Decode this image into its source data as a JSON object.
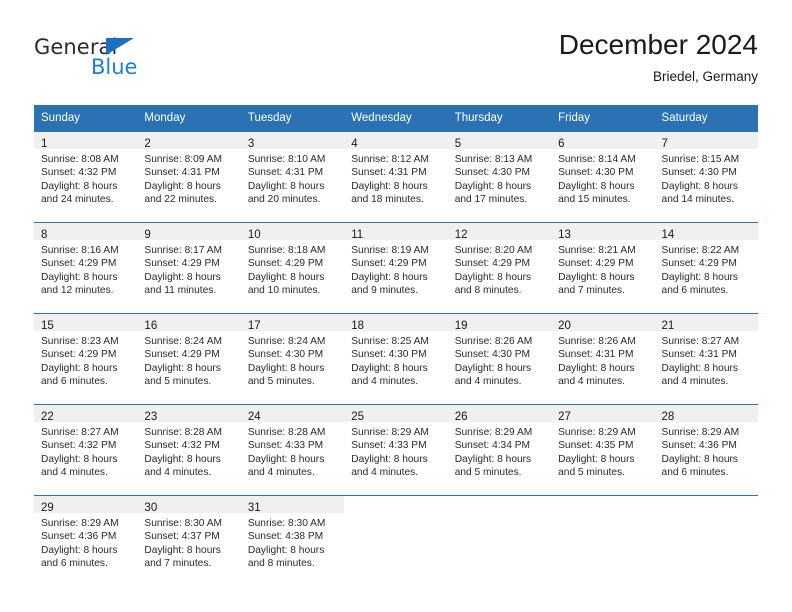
{
  "brand": {
    "name_part1": "General",
    "name_part2": "Blue",
    "accent_color": "#1b7fd4",
    "triangle_color": "#1b6ec2"
  },
  "header": {
    "title": "December 2024",
    "subtitle": "Briedel, Germany"
  },
  "calendar": {
    "header_bg": "#2b72b3",
    "daynum_bg": "#f0f0f0",
    "weekday_headers": [
      "Sunday",
      "Monday",
      "Tuesday",
      "Wednesday",
      "Thursday",
      "Friday",
      "Saturday"
    ],
    "weeks": [
      [
        {
          "day": "1",
          "lines": [
            "Sunrise: 8:08 AM",
            "Sunset: 4:32 PM",
            "Daylight: 8 hours",
            "and 24 minutes."
          ]
        },
        {
          "day": "2",
          "lines": [
            "Sunrise: 8:09 AM",
            "Sunset: 4:31 PM",
            "Daylight: 8 hours",
            "and 22 minutes."
          ]
        },
        {
          "day": "3",
          "lines": [
            "Sunrise: 8:10 AM",
            "Sunset: 4:31 PM",
            "Daylight: 8 hours",
            "and 20 minutes."
          ]
        },
        {
          "day": "4",
          "lines": [
            "Sunrise: 8:12 AM",
            "Sunset: 4:31 PM",
            "Daylight: 8 hours",
            "and 18 minutes."
          ]
        },
        {
          "day": "5",
          "lines": [
            "Sunrise: 8:13 AM",
            "Sunset: 4:30 PM",
            "Daylight: 8 hours",
            "and 17 minutes."
          ]
        },
        {
          "day": "6",
          "lines": [
            "Sunrise: 8:14 AM",
            "Sunset: 4:30 PM",
            "Daylight: 8 hours",
            "and 15 minutes."
          ]
        },
        {
          "day": "7",
          "lines": [
            "Sunrise: 8:15 AM",
            "Sunset: 4:30 PM",
            "Daylight: 8 hours",
            "and 14 minutes."
          ]
        }
      ],
      [
        {
          "day": "8",
          "lines": [
            "Sunrise: 8:16 AM",
            "Sunset: 4:29 PM",
            "Daylight: 8 hours",
            "and 12 minutes."
          ]
        },
        {
          "day": "9",
          "lines": [
            "Sunrise: 8:17 AM",
            "Sunset: 4:29 PM",
            "Daylight: 8 hours",
            "and 11 minutes."
          ]
        },
        {
          "day": "10",
          "lines": [
            "Sunrise: 8:18 AM",
            "Sunset: 4:29 PM",
            "Daylight: 8 hours",
            "and 10 minutes."
          ]
        },
        {
          "day": "11",
          "lines": [
            "Sunrise: 8:19 AM",
            "Sunset: 4:29 PM",
            "Daylight: 8 hours",
            "and 9 minutes."
          ]
        },
        {
          "day": "12",
          "lines": [
            "Sunrise: 8:20 AM",
            "Sunset: 4:29 PM",
            "Daylight: 8 hours",
            "and 8 minutes."
          ]
        },
        {
          "day": "13",
          "lines": [
            "Sunrise: 8:21 AM",
            "Sunset: 4:29 PM",
            "Daylight: 8 hours",
            "and 7 minutes."
          ]
        },
        {
          "day": "14",
          "lines": [
            "Sunrise: 8:22 AM",
            "Sunset: 4:29 PM",
            "Daylight: 8 hours",
            "and 6 minutes."
          ]
        }
      ],
      [
        {
          "day": "15",
          "lines": [
            "Sunrise: 8:23 AM",
            "Sunset: 4:29 PM",
            "Daylight: 8 hours",
            "and 6 minutes."
          ]
        },
        {
          "day": "16",
          "lines": [
            "Sunrise: 8:24 AM",
            "Sunset: 4:29 PM",
            "Daylight: 8 hours",
            "and 5 minutes."
          ]
        },
        {
          "day": "17",
          "lines": [
            "Sunrise: 8:24 AM",
            "Sunset: 4:30 PM",
            "Daylight: 8 hours",
            "and 5 minutes."
          ]
        },
        {
          "day": "18",
          "lines": [
            "Sunrise: 8:25 AM",
            "Sunset: 4:30 PM",
            "Daylight: 8 hours",
            "and 4 minutes."
          ]
        },
        {
          "day": "19",
          "lines": [
            "Sunrise: 8:26 AM",
            "Sunset: 4:30 PM",
            "Daylight: 8 hours",
            "and 4 minutes."
          ]
        },
        {
          "day": "20",
          "lines": [
            "Sunrise: 8:26 AM",
            "Sunset: 4:31 PM",
            "Daylight: 8 hours",
            "and 4 minutes."
          ]
        },
        {
          "day": "21",
          "lines": [
            "Sunrise: 8:27 AM",
            "Sunset: 4:31 PM",
            "Daylight: 8 hours",
            "and 4 minutes."
          ]
        }
      ],
      [
        {
          "day": "22",
          "lines": [
            "Sunrise: 8:27 AM",
            "Sunset: 4:32 PM",
            "Daylight: 8 hours",
            "and 4 minutes."
          ]
        },
        {
          "day": "23",
          "lines": [
            "Sunrise: 8:28 AM",
            "Sunset: 4:32 PM",
            "Daylight: 8 hours",
            "and 4 minutes."
          ]
        },
        {
          "day": "24",
          "lines": [
            "Sunrise: 8:28 AM",
            "Sunset: 4:33 PM",
            "Daylight: 8 hours",
            "and 4 minutes."
          ]
        },
        {
          "day": "25",
          "lines": [
            "Sunrise: 8:29 AM",
            "Sunset: 4:33 PM",
            "Daylight: 8 hours",
            "and 4 minutes."
          ]
        },
        {
          "day": "26",
          "lines": [
            "Sunrise: 8:29 AM",
            "Sunset: 4:34 PM",
            "Daylight: 8 hours",
            "and 5 minutes."
          ]
        },
        {
          "day": "27",
          "lines": [
            "Sunrise: 8:29 AM",
            "Sunset: 4:35 PM",
            "Daylight: 8 hours",
            "and 5 minutes."
          ]
        },
        {
          "day": "28",
          "lines": [
            "Sunrise: 8:29 AM",
            "Sunset: 4:36 PM",
            "Daylight: 8 hours",
            "and 6 minutes."
          ]
        }
      ],
      [
        {
          "day": "29",
          "lines": [
            "Sunrise: 8:29 AM",
            "Sunset: 4:36 PM",
            "Daylight: 8 hours",
            "and 6 minutes."
          ]
        },
        {
          "day": "30",
          "lines": [
            "Sunrise: 8:30 AM",
            "Sunset: 4:37 PM",
            "Daylight: 8 hours",
            "and 7 minutes."
          ]
        },
        {
          "day": "31",
          "lines": [
            "Sunrise: 8:30 AM",
            "Sunset: 4:38 PM",
            "Daylight: 8 hours",
            "and 8 minutes."
          ]
        },
        {
          "day": "",
          "lines": []
        },
        {
          "day": "",
          "lines": []
        },
        {
          "day": "",
          "lines": []
        },
        {
          "day": "",
          "lines": []
        }
      ]
    ]
  }
}
